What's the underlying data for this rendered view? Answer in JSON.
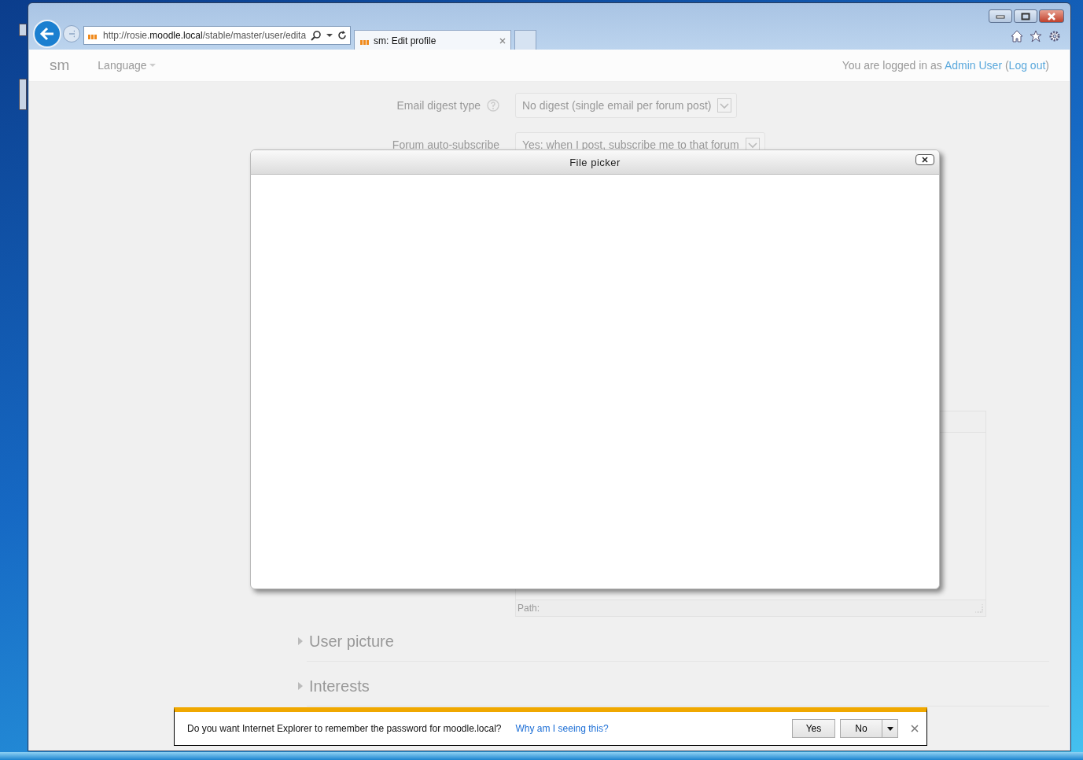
{
  "browser": {
    "address": "http://rosie.**moodle.local**/stable/master/user/edita",
    "tabs": [
      {
        "title": "sm: Edit profile",
        "selected": true
      }
    ]
  },
  "navbar": {
    "brand": "sm",
    "menu": "Language",
    "login_prefix": "You are logged in as ",
    "user_link": "Admin User",
    "logout_open": "(",
    "logout_link": "Log out",
    "logout_close": ")"
  },
  "form": {
    "fields": [
      {
        "label": "Email digest type",
        "value": "No digest (single email per forum post)",
        "help": true
      },
      {
        "label": "Forum auto-subscribe",
        "value": "Yes: when I post, subscribe me to that forum",
        "help": false
      }
    ],
    "editor": {
      "path_label": "Path:"
    },
    "sections": [
      {
        "title": "User picture",
        "expanded": false
      },
      {
        "title": "Interests",
        "expanded": false
      }
    ]
  },
  "dialog": {
    "title": "File picker"
  },
  "notification": {
    "message": "Do you want Internet Explorer to remember the password for moodle.local?",
    "link": "Why am I seeing this?",
    "buttons": [
      "Yes",
      "No"
    ]
  }
}
